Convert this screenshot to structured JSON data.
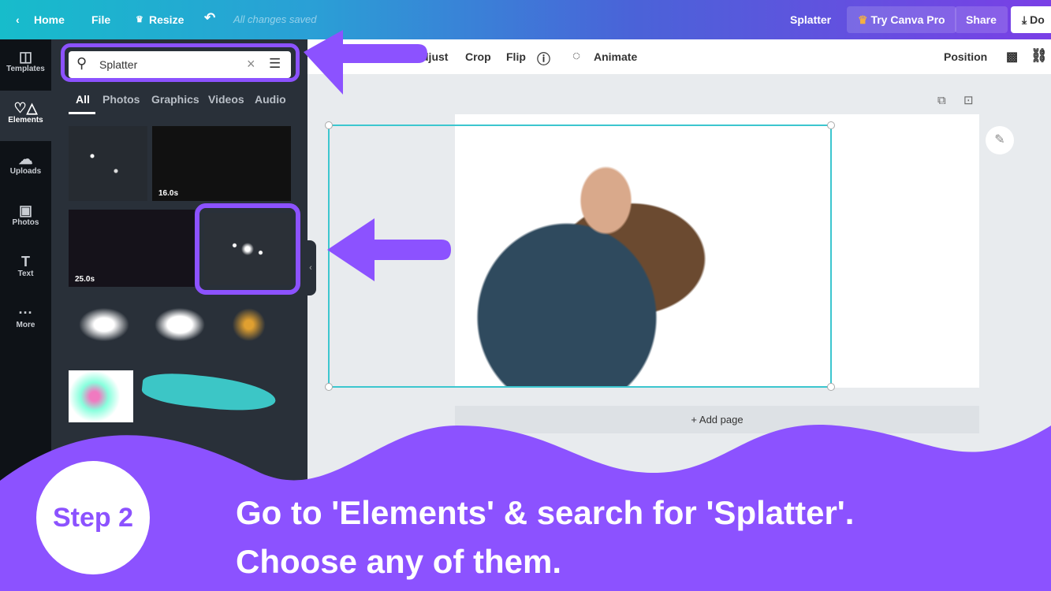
{
  "topbar": {
    "home": "Home",
    "file": "File",
    "resize": "Resize",
    "status": "All changes saved",
    "doc_title": "Splatter",
    "try_pro": "Try Canva Pro",
    "share": "Share",
    "download": "Do"
  },
  "rail": [
    {
      "label": "Templates"
    },
    {
      "label": "Elements"
    },
    {
      "label": "Uploads"
    },
    {
      "label": "Photos"
    },
    {
      "label": "Text"
    },
    {
      "label": "More"
    }
  ],
  "search": {
    "value": "Splatter"
  },
  "tabs": [
    "All",
    "Photos",
    "Graphics",
    "Videos",
    "Audio"
  ],
  "thumbs": {
    "d1": "16.0s",
    "d2": "25.0s"
  },
  "toolbar": {
    "adjust": "djust",
    "crop": "Crop",
    "flip": "Flip",
    "animate": "Animate",
    "position": "Position"
  },
  "canvas": {
    "add_page": "+ Add page"
  },
  "overlay": {
    "step": "Step 2",
    "line1": "Go to 'Elements' & search for 'Splatter'.",
    "line2": "Choose any of them."
  },
  "colors": {
    "accent": "#8c52ff",
    "selection": "#3cc6cf"
  }
}
